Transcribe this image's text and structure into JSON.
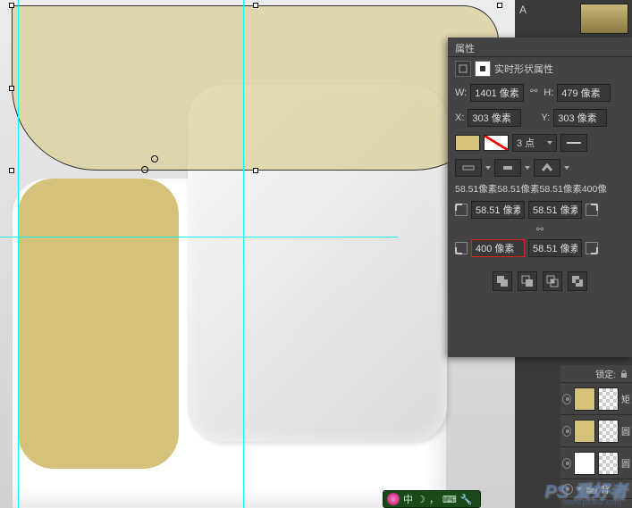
{
  "panel": {
    "title": "属性",
    "subtitle": "实时形状属性",
    "w_label": "W:",
    "w_value": "1401 像素",
    "h_label": "H:",
    "h_value": "479 像素",
    "x_label": "X:",
    "x_value": "303 像素",
    "y_label": "Y:",
    "y_value": "303 像素",
    "stroke_width": "3 点",
    "corners_summary": "58.51像素58.51像素58.51像素400像",
    "corner_tl": "58.51 像素",
    "corner_tr": "58.51 像素",
    "corner_bl": "400 像素",
    "corner_br": "58.51 像素"
  },
  "layers": {
    "lock_label": "锁定:",
    "item1": "矩",
    "item2": "圆",
    "item3": "圆",
    "folder": "背"
  },
  "ime": {
    "text": "中"
  },
  "watermark": {
    "text": "PS 爱好者",
    "url": "www.psahz.com"
  },
  "colors": {
    "fill": "#d4c27a"
  }
}
